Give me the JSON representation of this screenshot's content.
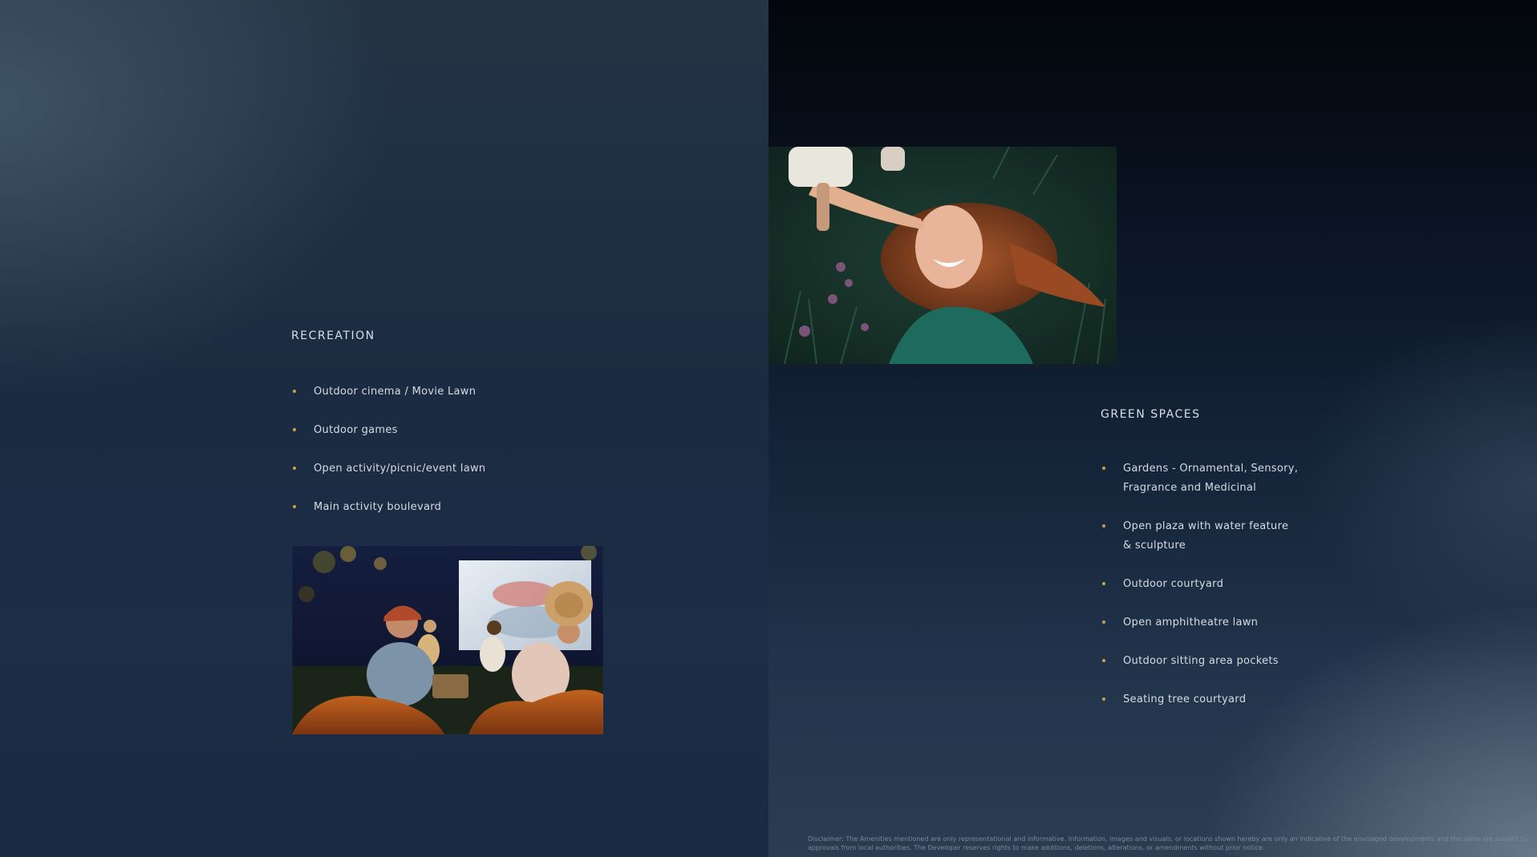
{
  "recreation": {
    "title": "RECREATION",
    "items": [
      "Outdoor cinema / Movie Lawn",
      "Outdoor games",
      "Open activity/picnic/event lawn",
      "Main activity boulevard"
    ]
  },
  "green_spaces": {
    "title": "GREEN SPACES",
    "items": [
      "Gardens - Ornamental, Sensory,\nFragrance and Medicinal",
      "Open plaza with water feature\n& sculpture",
      "Outdoor courtyard",
      "Open amphitheatre lawn",
      "Outdoor sitting area pockets",
      "Seating tree courtyard"
    ]
  },
  "disclaimer": "Disclaimer: The Amenities mentioned are only representational and informative. Information, images and visuals, or locations shown hereby are only an indicative of the envisaged developments and the same are subject to approvals from local authorities. The Developer reserves rights to make additions, deletions, alterations, or amendments without prior notice.",
  "colors": {
    "bullet_accent": "#c9a24a",
    "text": "#d5dbe2",
    "background": "#1b2b41"
  }
}
